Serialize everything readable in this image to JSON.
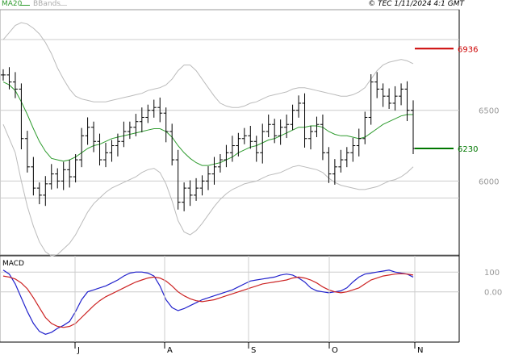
{
  "header": {
    "ma_label": "MA20",
    "bb_label": "BBands",
    "timestamp": "© TEC 1/11/2024 4:1 GMT"
  },
  "macd_label": "MACD",
  "colors": {
    "price": "#000000",
    "ma": "#2e9b2e",
    "bbands": "#bbbbbb",
    "resistance": "#cc0000",
    "support": "#007700",
    "macd": "#2222cc",
    "signal": "#cc2222",
    "grid": "#cccccc"
  },
  "chart_data": [
    {
      "type": "ohlc",
      "title": "",
      "y_ticks": [
        6000,
        6500
      ],
      "y_tick_labels": [
        "6000",
        "6500"
      ],
      "ylim": [
        5500,
        7200
      ],
      "x_ticks": [
        "J",
        "A",
        "S",
        "O",
        "N"
      ],
      "annotations": [
        {
          "label": "6936",
          "value": 6936,
          "color": "#cc0000"
        },
        {
          "label": "6230",
          "value": 6230,
          "color": "#007700"
        }
      ],
      "approx_close_series": [
        6750,
        6700,
        6650,
        6300,
        6100,
        5950,
        5900,
        5980,
        6050,
        6000,
        6080,
        6030,
        6150,
        6320,
        6380,
        6280,
        6150,
        6200,
        6250,
        6280,
        6350,
        6380,
        6420,
        6450,
        6500,
        6520,
        6480,
        6350,
        6150,
        5850,
        5950,
        5900,
        5950,
        6000,
        6050,
        6100,
        6150,
        6200,
        6250,
        6300,
        6320,
        6280,
        6200,
        6350,
        6400,
        6320,
        6380,
        6400,
        6500,
        6550,
        6300,
        6350,
        6400,
        6200,
        6050,
        6100,
        6150,
        6200,
        6250,
        6300,
        6450,
        6700,
        6650,
        6600,
        6550,
        6600,
        6650,
        6500,
        6230
      ],
      "series": [
        {
          "name": "MA20",
          "values": [
            6700,
            6680,
            6640,
            6560,
            6470,
            6370,
            6280,
            6210,
            6160,
            6150,
            6140,
            6150,
            6170,
            6200,
            6230,
            6250,
            6260,
            6280,
            6300,
            6310,
            6320,
            6330,
            6340,
            6350,
            6360,
            6370,
            6370,
            6350,
            6310,
            6250,
            6200,
            6160,
            6130,
            6110,
            6110,
            6120,
            6130,
            6150,
            6170,
            6200,
            6220,
            6240,
            6250,
            6270,
            6290,
            6300,
            6320,
            6340,
            6360,
            6380,
            6380,
            6390,
            6390,
            6380,
            6350,
            6330,
            6320,
            6320,
            6310,
            6300,
            6310,
            6340,
            6370,
            6400,
            6420,
            6440,
            6460,
            6470,
            6470
          ]
        },
        {
          "name": "BBands upper",
          "values": [
            7000,
            7050,
            7100,
            7120,
            7110,
            7080,
            7040,
            6980,
            6900,
            6800,
            6720,
            6650,
            6600,
            6580,
            6570,
            6560,
            6560,
            6560,
            6570,
            6580,
            6590,
            6600,
            6610,
            6620,
            6640,
            6650,
            6660,
            6680,
            6720,
            6780,
            6820,
            6820,
            6780,
            6720,
            6660,
            6600,
            6550,
            6530,
            6520,
            6520,
            6530,
            6550,
            6560,
            6580,
            6600,
            6610,
            6620,
            6630,
            6650,
            6660,
            6660,
            6650,
            6640,
            6630,
            6620,
            6610,
            6600,
            6600,
            6610,
            6630,
            6660,
            6720,
            6780,
            6820,
            6840,
            6850,
            6860,
            6850,
            6830
          ]
        },
        {
          "name": "BBands lower",
          "values": [
            6400,
            6300,
            6200,
            6000,
            5820,
            5680,
            5570,
            5500,
            5470,
            5480,
            5520,
            5560,
            5620,
            5700,
            5780,
            5840,
            5880,
            5920,
            5950,
            5970,
            5990,
            6010,
            6030,
            6060,
            6080,
            6090,
            6060,
            5980,
            5860,
            5720,
            5640,
            5620,
            5650,
            5700,
            5760,
            5820,
            5870,
            5910,
            5940,
            5960,
            5980,
            5990,
            6000,
            6020,
            6040,
            6050,
            6060,
            6080,
            6100,
            6110,
            6100,
            6090,
            6080,
            6060,
            6020,
            5990,
            5970,
            5960,
            5950,
            5940,
            5940,
            5950,
            5960,
            5980,
            6000,
            6010,
            6030,
            6060,
            6100
          ]
        }
      ]
    },
    {
      "type": "line",
      "title": "MACD",
      "y_ticks": [
        0,
        100
      ],
      "y_tick_labels": [
        "0.00",
        "100"
      ],
      "ylim": [
        -230,
        150
      ],
      "x_ticks": [
        "J",
        "A",
        "S",
        "O",
        "N"
      ],
      "series": [
        {
          "name": "MACD",
          "values": [
            110,
            90,
            40,
            -30,
            -100,
            -160,
            -200,
            -215,
            -205,
            -185,
            -170,
            -150,
            -100,
            -40,
            0,
            10,
            20,
            30,
            45,
            60,
            80,
            95,
            100,
            100,
            95,
            80,
            30,
            -40,
            -80,
            -95,
            -85,
            -70,
            -55,
            -40,
            -30,
            -20,
            -10,
            0,
            10,
            25,
            40,
            55,
            60,
            65,
            70,
            75,
            85,
            90,
            85,
            70,
            50,
            20,
            5,
            0,
            -5,
            0,
            5,
            20,
            50,
            75,
            90,
            95,
            100,
            105,
            110,
            100,
            95,
            90,
            75
          ]
        },
        {
          "name": "Signal",
          "values": [
            80,
            75,
            65,
            45,
            15,
            -30,
            -80,
            -130,
            -160,
            -175,
            -180,
            -175,
            -160,
            -130,
            -100,
            -70,
            -45,
            -25,
            -10,
            5,
            20,
            35,
            50,
            60,
            70,
            75,
            70,
            55,
            30,
            0,
            -20,
            -35,
            -45,
            -50,
            -45,
            -40,
            -30,
            -20,
            -10,
            0,
            10,
            20,
            30,
            40,
            45,
            50,
            55,
            60,
            70,
            75,
            70,
            60,
            45,
            25,
            10,
            0,
            -5,
            0,
            10,
            20,
            40,
            60,
            70,
            80,
            85,
            90,
            92,
            90,
            85
          ]
        }
      ]
    }
  ]
}
